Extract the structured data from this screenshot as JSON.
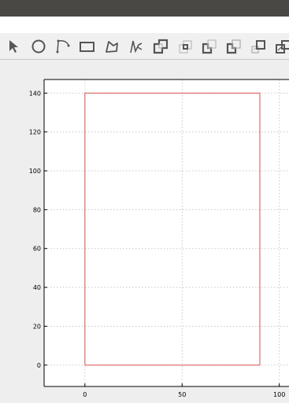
{
  "toolbar": {
    "tools": [
      {
        "name": "select-arrow-icon"
      },
      {
        "name": "circle-icon"
      },
      {
        "name": "bezier-curve-icon"
      },
      {
        "name": "rectangle-icon"
      },
      {
        "name": "polygon-icon"
      },
      {
        "name": "freehand-line-icon"
      },
      {
        "name": "union-icon"
      },
      {
        "name": "intersection-icon"
      },
      {
        "name": "difference-icon"
      },
      {
        "name": "exclusion-icon"
      },
      {
        "name": "bring-forward-icon"
      },
      {
        "name": "send-backward-icon"
      }
    ]
  },
  "colors": {
    "titlebar": "#4a4845",
    "shape_stroke": "#d9534f",
    "grid": "#c8c8c8"
  },
  "chart_data": {
    "type": "line",
    "title": "",
    "xlabel": "",
    "ylabel": "",
    "xlim": [
      -21,
      105
    ],
    "ylim": [
      -11,
      147
    ],
    "xticks": [
      0,
      50,
      100
    ],
    "yticks": [
      0,
      20,
      40,
      60,
      80,
      100,
      120,
      140
    ],
    "grid": true,
    "series": [
      {
        "x": [
          0,
          90,
          90,
          0,
          0
        ],
        "y": [
          0,
          0,
          140,
          140,
          0
        ]
      }
    ]
  }
}
